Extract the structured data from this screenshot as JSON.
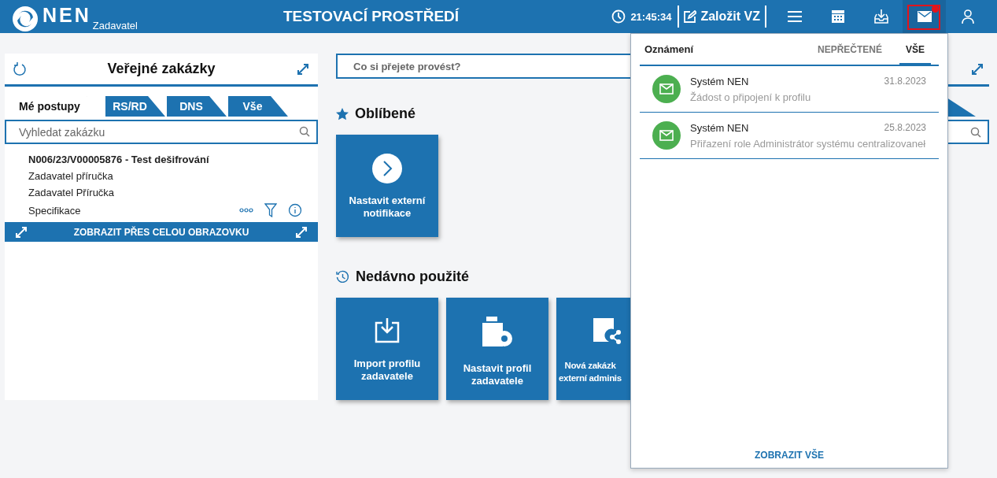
{
  "header": {
    "logo": "NEN",
    "logo_sub": "Zadavatel",
    "title": "TESTOVACÍ PROSTŘEDÍ",
    "time": "21:45:34",
    "create_button": "Založit VZ",
    "toolbar": [
      {
        "kind": "menu",
        "selected": false,
        "badge": false
      },
      {
        "kind": "calendar",
        "selected": false,
        "badge": false
      },
      {
        "kind": "inbox",
        "selected": false,
        "badge": false
      },
      {
        "kind": "mail",
        "selected": true,
        "badge": true
      },
      {
        "kind": "user",
        "selected": false,
        "badge": false
      }
    ]
  },
  "left_panel": {
    "title": "Veřejné zakázky",
    "tabs": [
      {
        "label": "Mé postupy",
        "selected": true
      },
      {
        "label": "RS/RD",
        "selected": false
      },
      {
        "label": "DNS",
        "selected": false
      },
      {
        "label": "Vše",
        "selected": false
      }
    ],
    "search": {
      "placeholder": "Vyhledat zakázku"
    },
    "item": {
      "title": "N006/23/V00005876 - Test dešifrování",
      "lines": [
        "Zadavatel příručka",
        "Zadavatel Příručka",
        "Specifikace"
      ]
    },
    "footer": "ZOBRAZIT PŘES CELOU OBRAZOVKU"
  },
  "command_search": {
    "placeholder": "Co si přejete provést?"
  },
  "favorites": {
    "title": "Oblíbené",
    "tiles": [
      {
        "kind": "arrow",
        "lines": [
          "Nastavit externí",
          "notifikace"
        ]
      }
    ]
  },
  "recent": {
    "title": "Nedávno použité",
    "tiles": [
      {
        "kind": "import",
        "lines": [
          "Import profilu",
          "zadavatele"
        ]
      },
      {
        "kind": "profile",
        "lines": [
          "Nastavit profil",
          "zadavatele"
        ]
      },
      {
        "kind": "share",
        "lines": [
          "Nová zakázk",
          "externí adminis"
        ]
      }
    ]
  },
  "notifications": {
    "title": "Oznámení",
    "tabs": [
      {
        "label": "NEPŘEČTENÉ",
        "selected": false
      },
      {
        "label": "VŠE",
        "selected": true
      }
    ],
    "items": [
      {
        "sender": "Systém NEN",
        "date": "31.8.2023",
        "message": "Žádost o připojení k profilu"
      },
      {
        "sender": "Systém NEN",
        "date": "25.8.2023",
        "message": "Přiřazení role Administrátor systému centralizovaneł"
      }
    ],
    "footer": "ZOBRAZIT VŠE"
  }
}
